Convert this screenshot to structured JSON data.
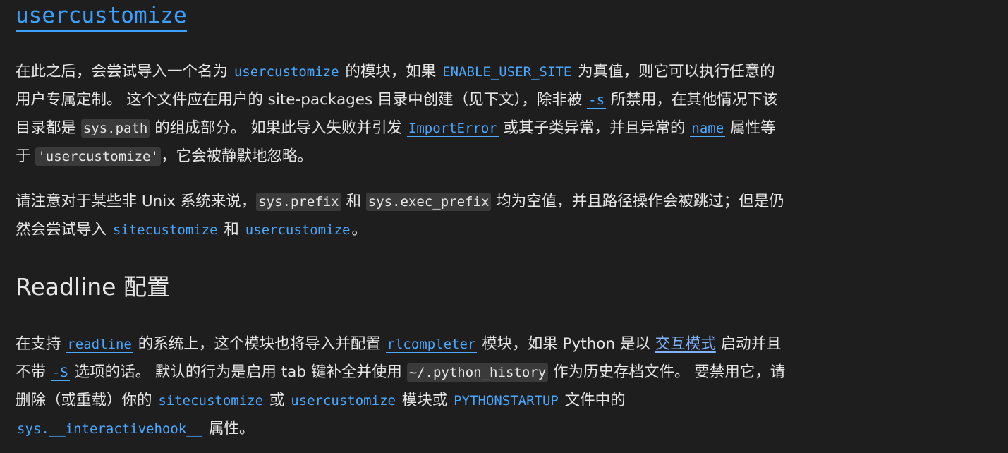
{
  "heading_link": "usercustomize",
  "para1": {
    "l1": {
      "t1": "在此之后，会尝试导入一个名为 ",
      "c1": "usercustomize",
      "t2": " 的模块，如果 ",
      "c2": "ENABLE_USER_SITE",
      "t3": " 为真值，则它可以执行任意的"
    },
    "l2": {
      "t1": "用户专属定制。 这个文件应在用户的 site-packages 目录中创建（见下文），除非被 ",
      "c1": "-s",
      "t2": " 所禁用，在其他情况下该"
    },
    "l3": {
      "t1": "目录都是 ",
      "lit1": "sys.path",
      "t2": " 的组成部分。 如果此导入失败并引发 ",
      "c1": "ImportError",
      "t3": " 或其子类异常，并且异常的 ",
      "c2": "name",
      "t4": " 属性等"
    },
    "l4": {
      "t1": "于 ",
      "lit1": "'usercustomize'",
      "t2": "，它会被静默地忽略。"
    }
  },
  "para2": {
    "l1": {
      "t1": "请注意对于某些非 Unix 系统来说，",
      "lit1": "sys.prefix",
      "t2": " 和 ",
      "lit2": "sys.exec_prefix",
      "t3": " 均为空值，并且路径操作会被跳过；但是仍"
    },
    "l2": {
      "t1": "然会尝试导入 ",
      "c1": "sitecustomize",
      "t2": " 和 ",
      "c2": "usercustomize",
      "t3": "。"
    }
  },
  "section_heading": "Readline 配置",
  "para3": {
    "l1": {
      "t1": "在支持 ",
      "c1": "readline",
      "t2": " 的系统上，这个模块也将导入并配置 ",
      "c2": "rlcompleter",
      "t3": " 模块，如果 Python 是以 ",
      "link1": "交互模式",
      "t4": " 启动并且"
    },
    "l2": {
      "t1": "不带 ",
      "c1": "-S",
      "t2": " 选项的话。 默认的行为是启用 tab 键补全并使用 ",
      "lit1": "~/.python_history",
      "t3": " 作为历史存档文件。 要禁用它，请"
    },
    "l3": {
      "t1": "删除（或重载）你的 ",
      "c1": "sitecustomize",
      "t2": " 或 ",
      "c2": "usercustomize",
      "t3": " 模块或 ",
      "c3": "PYTHONSTARTUP",
      "t4": " 文件中的"
    },
    "l4": {
      "c1": "sys.__interactivehook__",
      "t1": " 属性。"
    }
  }
}
